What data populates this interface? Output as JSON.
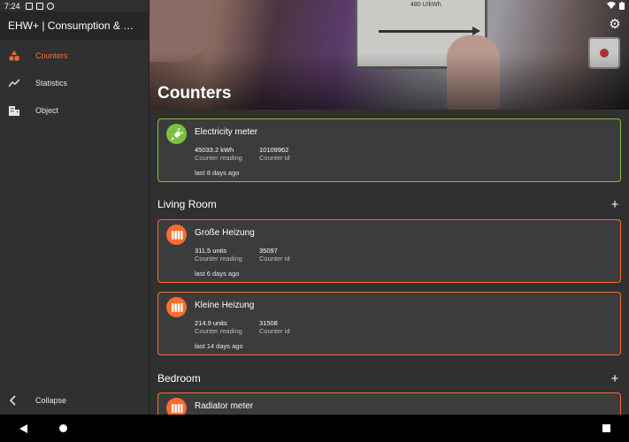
{
  "status_bar": {
    "time": "7:24"
  },
  "app": {
    "title": "EHW+ | Consumption & mete..."
  },
  "sidebar": {
    "items": [
      {
        "label": "Counters",
        "icon": "shapes-icon",
        "active": true
      },
      {
        "label": "Statistics",
        "icon": "chart-line-icon",
        "active": false
      },
      {
        "label": "Object",
        "icon": "building-icon",
        "active": false
      }
    ],
    "collapse_label": "Collapse"
  },
  "header": {
    "title": "Counters",
    "meter_reading": "480 U/kWh"
  },
  "electricity": {
    "name": "Electricity meter",
    "reading": "45033.2 kWh",
    "reading_label": "Counter reading",
    "id": "10109962",
    "id_label": "Counter id",
    "last": "last 8 days ago"
  },
  "sections": [
    {
      "title": "Living Room",
      "counters": [
        {
          "name": "Große Heizung",
          "reading": "311.5 units",
          "reading_label": "Counter reading",
          "id": "35097",
          "id_label": "Counter id",
          "last": "last 6 days ago"
        },
        {
          "name": "Kleine Heizung",
          "reading": "214.9 units",
          "reading_label": "Counter reading",
          "id": "31508",
          "id_label": "Counter id",
          "last": "last 14 days ago"
        }
      ]
    },
    {
      "title": "Bedroom",
      "counters": [
        {
          "name": "Radiator meter"
        }
      ]
    }
  ],
  "colors": {
    "accent": "#ff6b30",
    "electric": "#7cc141",
    "background": "#303030",
    "card": "#3c3c3c"
  }
}
